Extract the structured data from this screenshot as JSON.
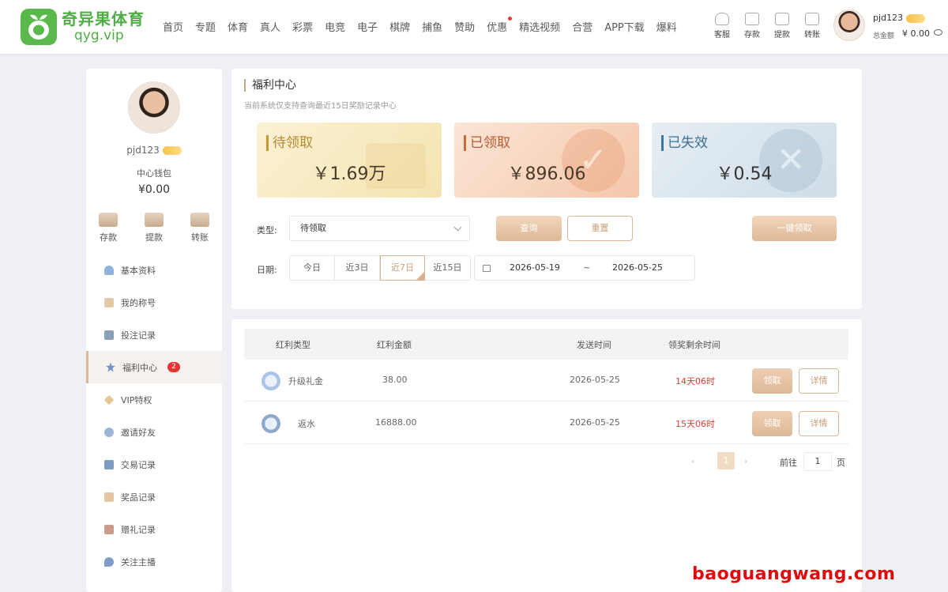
{
  "header": {
    "logo_cn": "奇异果体育",
    "logo_en": "qyg.vip",
    "nav": [
      "首页",
      "专题",
      "体育",
      "真人",
      "彩票",
      "电竞",
      "电子",
      "棋牌",
      "捕鱼",
      "赞助",
      "优惠",
      "精选视频",
      "合营",
      "APP下载",
      "爆料"
    ],
    "quick": [
      "客服",
      "存款",
      "提款",
      "转账"
    ],
    "user_name": "pjd123",
    "balance_label": "总金额",
    "balance": "¥ 0.00"
  },
  "sidebar": {
    "name": "pjd123",
    "wallet_label": "中心钱包",
    "wallet_value": "¥0.00",
    "actions": [
      "存款",
      "提款",
      "转账"
    ],
    "menu": [
      "基本资料",
      "我的称号",
      "投注记录",
      "福利中心",
      "VIP特权",
      "邀请好友",
      "交易记录",
      "奖品记录",
      "赠礼记录",
      "关注主播"
    ],
    "badge": "2"
  },
  "welfare": {
    "title": "福利中心",
    "subtitle": "当前系统仅支持查询最近15日奖励记录中心",
    "cards": [
      {
        "label": "待领取",
        "amount": "￥1.69万"
      },
      {
        "label": "已领取",
        "amount": "￥896.06"
      },
      {
        "label": "已失效",
        "amount": "￥0.54"
      }
    ],
    "type_label": "类型:",
    "type_value": "待领取",
    "query": "查询",
    "reset": "重置",
    "claim_all": "一键领取",
    "date_label": "日期:",
    "date_options": [
      "今日",
      "近3日",
      "近7日",
      "近15日"
    ],
    "date_from": "2026-05-19",
    "date_sep": "~",
    "date_to": "2026-05-25"
  },
  "table": {
    "headers": [
      "红利类型",
      "红利金额",
      "发送时间",
      "领奖剩余时间"
    ],
    "rows": [
      {
        "type": "升级礼金",
        "amount": "38.00",
        "time": "2026-05-25",
        "remain": "14天06时",
        "claim": "领取",
        "detail": "详情"
      },
      {
        "type": "返水",
        "amount": "16888.00",
        "time": "2026-05-25",
        "remain": "15天06时",
        "claim": "领取",
        "detail": "详情"
      }
    ],
    "pager": {
      "prev": "‹",
      "page": "1",
      "next": "›",
      "goto": "前往",
      "input": "1",
      "unit": "页"
    }
  },
  "watermark": "baoguangwang.com",
  "colors": {
    "brand": "#5bb94c",
    "accent": "#deb896",
    "danger": "#e53a2f"
  }
}
